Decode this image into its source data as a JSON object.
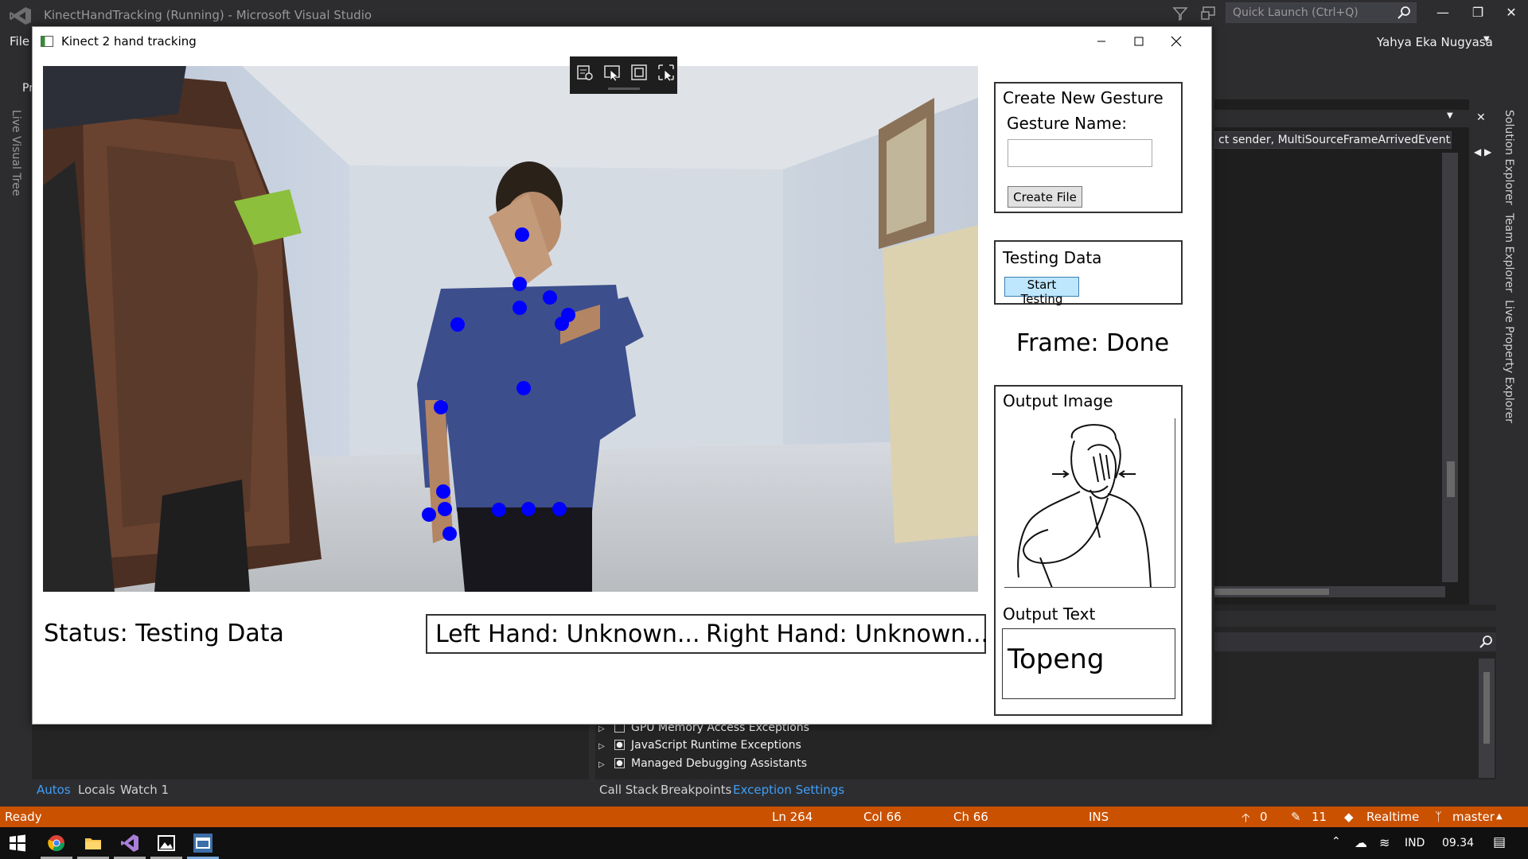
{
  "vs": {
    "title": "KinectHandTracking (Running) - Microsoft Visual Studio",
    "quick_launch_placeholder": "Quick Launch (Ctrl+Q)",
    "user": "Yahya Eka Nugyasa",
    "menu_file": "File",
    "left_tab": "Live Visual Tree",
    "pr_fragment": "Pr",
    "method_combo": "ct sender, MultiSourceFrameArrivedEventArg",
    "right_tabs": [
      "Solution Explorer",
      "Team Explorer",
      "Live Property Explorer"
    ],
    "exceptions": [
      {
        "label": "GPU Memory Access Exceptions",
        "checked": false
      },
      {
        "label": "JavaScript Runtime Exceptions",
        "checked": true
      },
      {
        "label": "Managed Debugging Assistants",
        "checked": true
      }
    ],
    "bottom_tabs_left": [
      "Autos",
      "Locals",
      "Watch 1"
    ],
    "bottom_tabs_right": [
      "Call Stack",
      "Breakpoints",
      "Exception Settings"
    ],
    "status": {
      "ready": "Ready",
      "ln": "Ln 264",
      "col": "Col 66",
      "ch": "Ch 66",
      "ins": "INS",
      "up_count": "0",
      "edit_count": "11",
      "realtime": "Realtime",
      "branch": "master"
    },
    "tray": {
      "lang": "IND",
      "time": "09.34"
    }
  },
  "kinect": {
    "window_title": "Kinect 2 hand tracking",
    "status_label": "Status: Testing Data",
    "left_hand": "Left Hand: Unknown...",
    "right_hand": "Right Hand: Unknown...",
    "create_gesture_title": "Create New Gesture",
    "gesture_name_label": "Gesture Name:",
    "gesture_name_value": "",
    "create_file_button": "Create File",
    "testing_title": "Testing Data",
    "start_testing_button": "Start Testing",
    "frame_status": "Frame: Done",
    "output_image_title": "Output Image",
    "output_text_title": "Output Text",
    "output_text_value": "Topeng",
    "joint_color": "#0000ff"
  },
  "colors": {
    "vs_background": "#2d2d30",
    "status_bar": "#ca5100",
    "accent_blue": "#3e9ff8",
    "button_highlight": "#bee6fd"
  }
}
